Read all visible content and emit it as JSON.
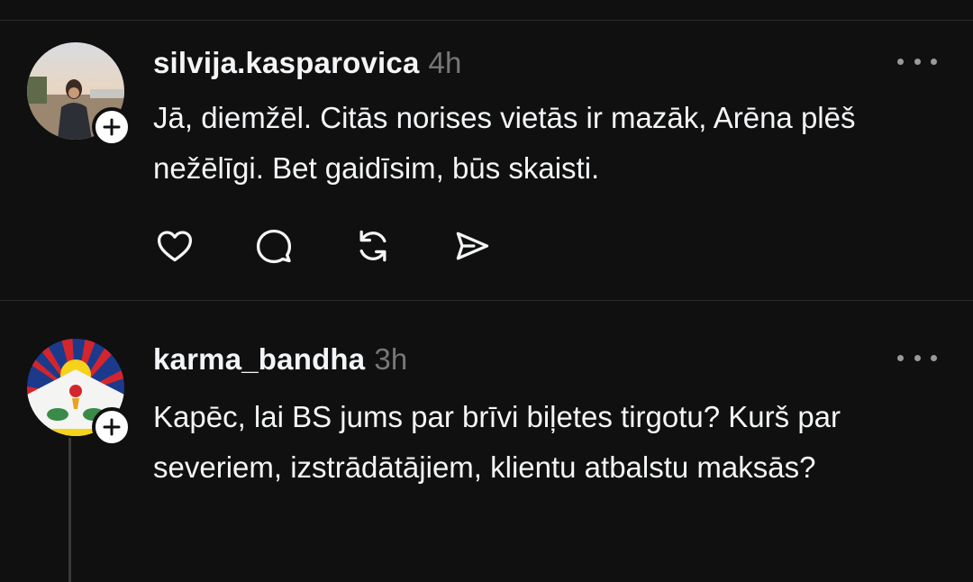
{
  "posts": [
    {
      "username": "silvija.kasparovica",
      "time": "4h",
      "text": "Jā, diemžēl. Citās norises vietās ir mazāk, Arēna plēš nežēlīgi. Bet gaidīsim, būs skaisti.",
      "actions": [
        "heart-icon",
        "comment-icon",
        "repost-icon",
        "share-icon"
      ]
    },
    {
      "username": "karma_bandha",
      "time": "3h",
      "text": "Kapēc, lai BS jums par brīvi biļetes tirgotu? Kurš par severiem, izstrādātājiem, klientu atbalstu maksās?"
    }
  ],
  "colors": {
    "background": "#101010",
    "text": "#f3f5f7",
    "muted": "#777777",
    "divider": "#2a2a2a"
  }
}
